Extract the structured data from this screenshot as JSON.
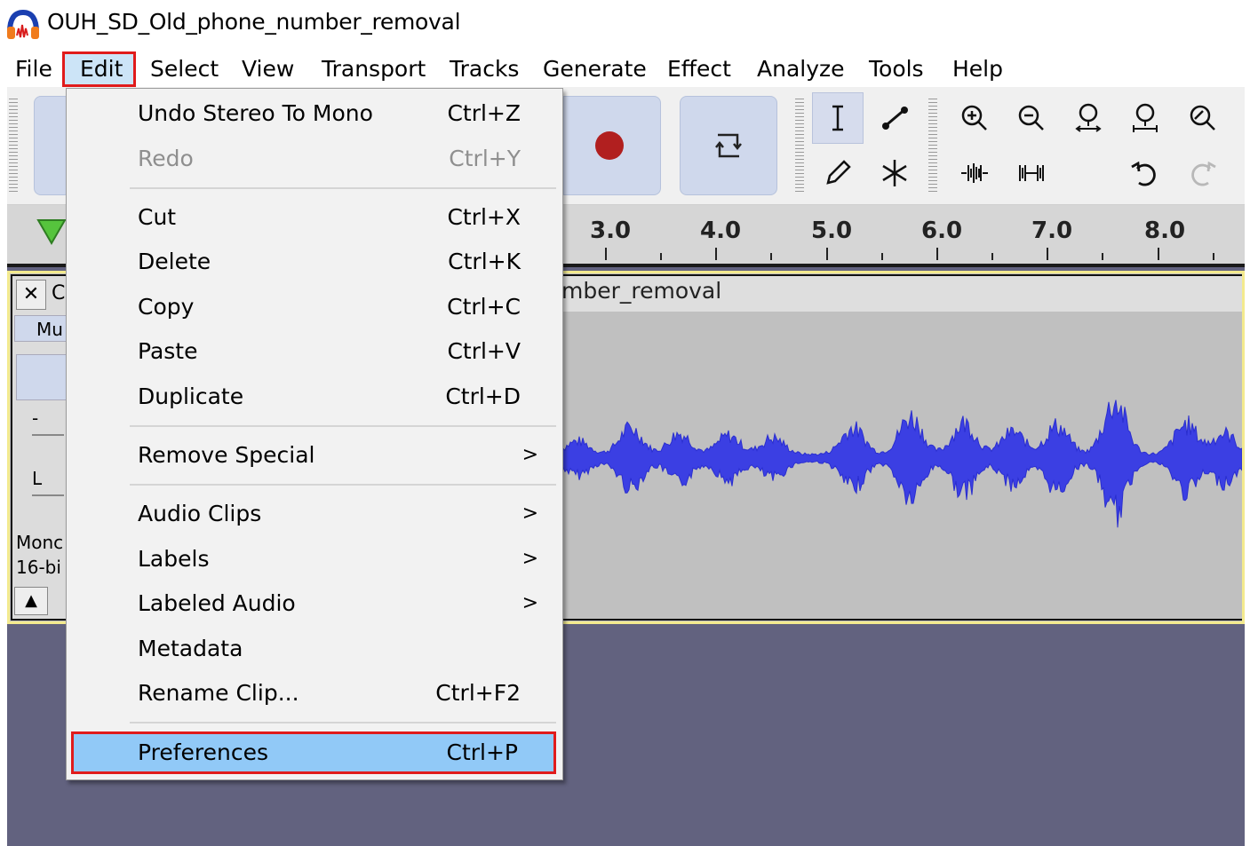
{
  "window": {
    "title": "OUH_SD_Old_phone_number_removal"
  },
  "menubar": {
    "items": [
      "File",
      "Edit",
      "Select",
      "View",
      "Transport",
      "Tracks",
      "Generate",
      "Effect",
      "Analyze",
      "Tools",
      "Help"
    ],
    "active": "Edit"
  },
  "edit_menu": {
    "undo": {
      "label": "Undo Stereo To Mono",
      "shortcut": "Ctrl+Z"
    },
    "redo": {
      "label": "Redo",
      "shortcut": "Ctrl+Y"
    },
    "cut": {
      "label": "Cut",
      "shortcut": "Ctrl+X"
    },
    "delete": {
      "label": "Delete",
      "shortcut": "Ctrl+K"
    },
    "copy": {
      "label": "Copy",
      "shortcut": "Ctrl+C"
    },
    "paste": {
      "label": "Paste",
      "shortcut": "Ctrl+V"
    },
    "duplicate": {
      "label": "Duplicate",
      "shortcut": "Ctrl+D"
    },
    "remove_special": {
      "label": "Remove Special",
      "submenu": ">"
    },
    "audio_clips": {
      "label": "Audio Clips",
      "submenu": ">"
    },
    "labels": {
      "label": "Labels",
      "submenu": ">"
    },
    "labeled_audio": {
      "label": "Labeled Audio",
      "submenu": ">"
    },
    "metadata": {
      "label": "Metadata"
    },
    "rename_clip": {
      "label": "Rename Clip...",
      "shortcut": "Ctrl+F2"
    },
    "preferences": {
      "label": "Preferences",
      "shortcut": "Ctrl+P"
    }
  },
  "ruler": {
    "ticks": [
      "3.0",
      "4.0",
      "5.0",
      "6.0",
      "7.0",
      "8.0"
    ]
  },
  "track": {
    "close": "✕",
    "name_partial": "C",
    "mute_partial": "Mu",
    "gain_minus": "-",
    "pan_left": "L",
    "format_line1": "Monc",
    "format_line2": "16-bi",
    "collapse": "▲",
    "clip_title": "mber_removal"
  },
  "icons": [
    "audacity-logo-icon",
    "record-icon",
    "loop-icon",
    "selection-tool-icon",
    "envelope-tool-icon",
    "draw-tool-icon",
    "multi-tool-icon",
    "zoom-in-icon",
    "zoom-out-icon",
    "fit-selection-icon",
    "fit-project-icon",
    "zoom-toggle-icon",
    "trim-audio-icon",
    "silence-audio-icon",
    "undo-icon",
    "redo-icon",
    "play-meter-icon"
  ],
  "colors": {
    "highlight_border": "#e01b1b",
    "selected_item": "#91c9f7",
    "waveform": "#3b3fe3",
    "workspace": "#62627f"
  }
}
